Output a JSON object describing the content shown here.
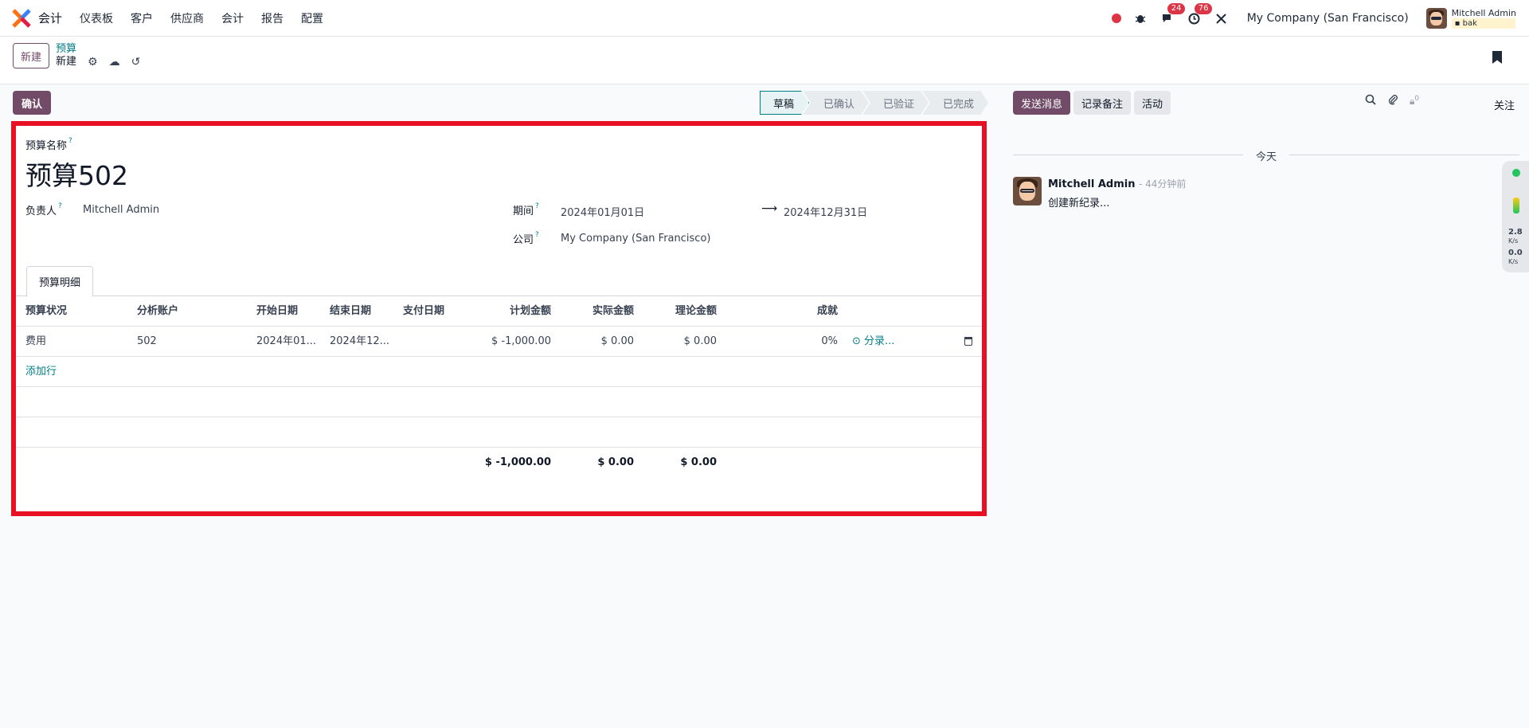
{
  "navbar": {
    "app_name": "会计",
    "menu": [
      "仪表板",
      "客户",
      "供应商",
      "会计",
      "报告",
      "配置"
    ],
    "messages_count": "24",
    "activities_count": "76",
    "company": "My Company (San Francisco)",
    "user_name": "Mitchell Admin",
    "user_db": "bak"
  },
  "control": {
    "new_label": "新建",
    "breadcrumb_parent": "预算",
    "breadcrumb_current": "新建"
  },
  "actions": {
    "confirm_label": "确认"
  },
  "status": [
    "草稿",
    "已确认",
    "已验证",
    "已完成"
  ],
  "form": {
    "name_label": "预算名称",
    "help_mark": "?",
    "title": "预算502",
    "responsible_label": "负责人",
    "responsible_value": "Mitchell Admin",
    "period_label": "期间",
    "period_start": "2024年01月01日",
    "period_end": "2024年12月31日",
    "company_label": "公司",
    "company_value": "My Company (San Francisco)",
    "tab_label": "预算明细"
  },
  "lines": {
    "headers": [
      "预算状况",
      "分析账户",
      "开始日期",
      "结束日期",
      "支付日期",
      "计划金额",
      "实际金额",
      "理论金额",
      "成就"
    ],
    "rows": [
      {
        "position": "费用",
        "account": "502",
        "start": "2024年01...",
        "end": "2024年12...",
        "paid": "",
        "planned": "$ -1,000.00",
        "actual": "$ 0.00",
        "theoretical": "$ 0.00",
        "achievement": "0%",
        "entries_link": "分录..."
      }
    ],
    "add_line": "添加行",
    "totals": {
      "planned": "$ -1,000.00",
      "actual": "$ 0.00",
      "theoretical": "$ 0.00"
    }
  },
  "chatter": {
    "send_message": "发送消息",
    "log_note": "记录备注",
    "activity": "活动",
    "followers_count": "0",
    "follow_label": "关注",
    "today_label": "今天",
    "message": {
      "author": "Mitchell Admin",
      "time": "- 44分钟前",
      "body": "创建新纪录..."
    }
  },
  "widget": {
    "upload": "2.8",
    "download": "0.0",
    "unit": "K/s"
  },
  "colors": {
    "brand": "#714b67",
    "accent": "#017e84",
    "highlight_border": "#e81123"
  }
}
